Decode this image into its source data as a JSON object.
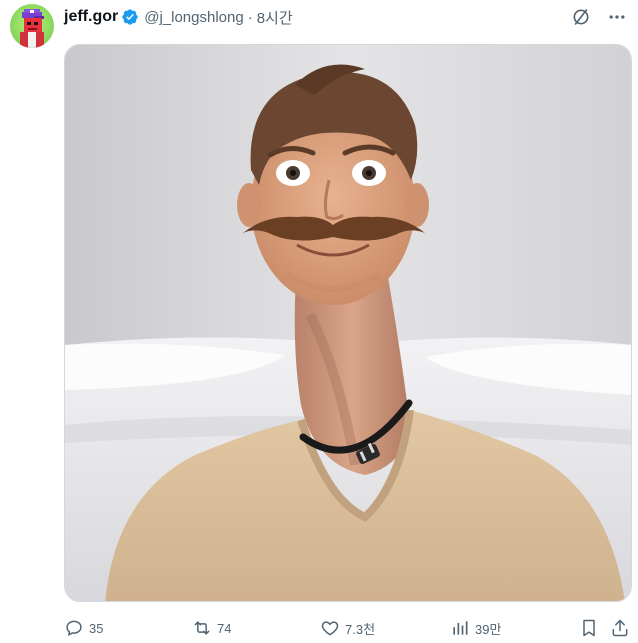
{
  "author": {
    "display_name": "jeff.gor",
    "handle": "@j_longshlong",
    "separator": "·",
    "time": "8시간",
    "verified": true,
    "avatar_icon": "pixel-character-avatar"
  },
  "top_icons": [
    "grok-icon",
    "more-options-icon"
  ],
  "media": {
    "kind": "photo",
    "icon": "photo-man-with-long-neck-and-mustache"
  },
  "actions": {
    "reply_count": "35",
    "repost_count": "74",
    "like_count": "7.3천",
    "views_count": "39만"
  },
  "colors": {
    "text_primary": "#0f1419",
    "text_secondary": "#536471",
    "verified": "#1d9bf0",
    "border": "#cfd9de"
  }
}
